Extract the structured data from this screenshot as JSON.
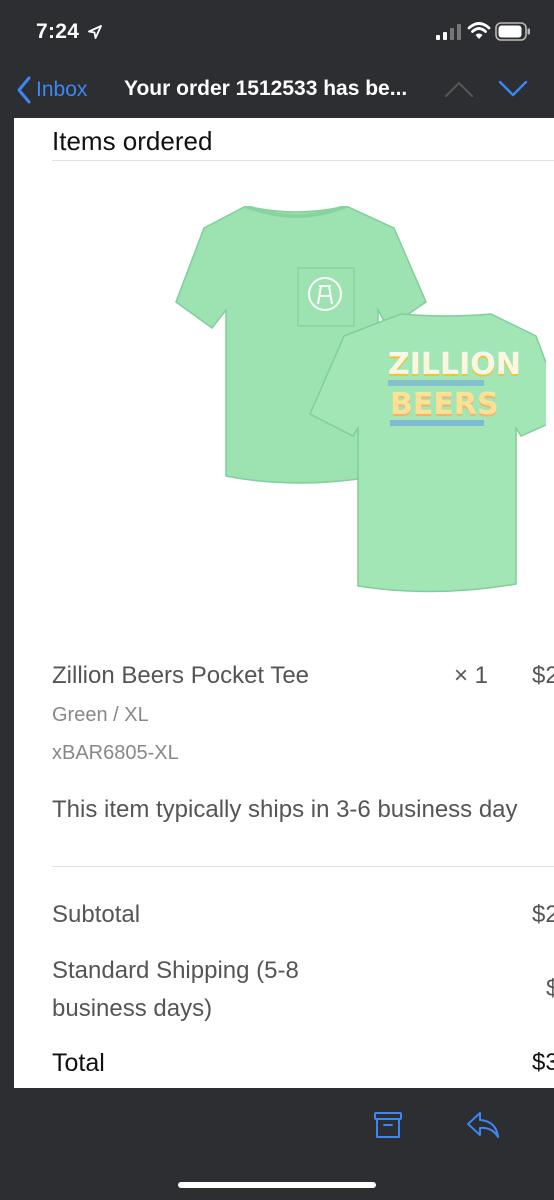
{
  "status_bar": {
    "time": "7:24"
  },
  "nav": {
    "back_label": "Inbox",
    "title": "Your order 1512533 has be..."
  },
  "email": {
    "section_heading": "Items ordered",
    "product_image": {
      "description_icon": "t-shirt-image",
      "print_line1": "ZILLION",
      "print_line2": "BEERS"
    },
    "item": {
      "name": "Zillion Beers Pocket Tee",
      "quantity": "× 1",
      "price": "$2",
      "variant": "Green / XL",
      "sku": "xBAR6805-XL",
      "ship_note": "This item typically ships in 3-6 business day"
    },
    "summary": {
      "subtotal_label": "Subtotal",
      "subtotal_amount": "$2",
      "shipping_label": "Standard Shipping (5-8 business days)",
      "shipping_amount": "$",
      "total_label": "Total",
      "total_amount": "$3"
    }
  },
  "toolbar": {
    "archive_icon": "archive-icon",
    "reply_icon": "reply-icon"
  },
  "colors": {
    "chrome_bg": "#2d2e31",
    "accent": "#3d86f5",
    "shirt": "#9de3b2"
  }
}
